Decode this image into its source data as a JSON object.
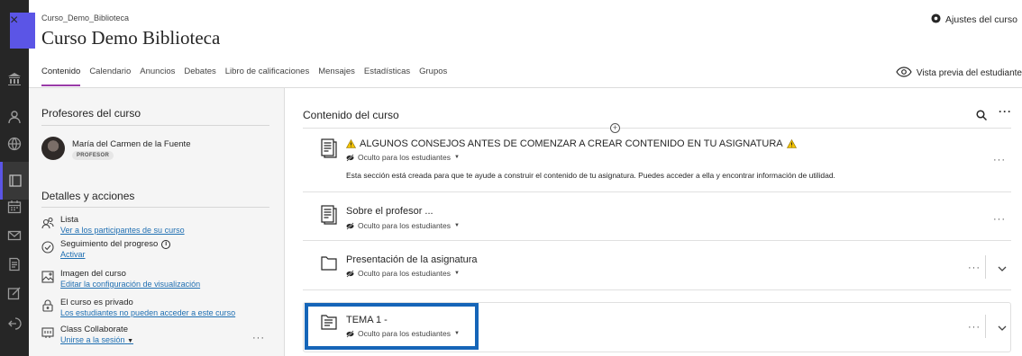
{
  "rail": {
    "close_label": "×",
    "icons": [
      "institution-icon",
      "user-icon",
      "globe-icon",
      "courses-icon",
      "calendar-icon",
      "mail-icon",
      "grades-icon",
      "tools-icon",
      "signout-icon"
    ]
  },
  "header": {
    "breadcrumb": "Curso_Demo_Biblioteca",
    "title": "Curso Demo Biblioteca",
    "settings_label": "Ajustes del curso"
  },
  "tabs": [
    {
      "label": "Contenido",
      "active": true
    },
    {
      "label": "Calendario",
      "active": false
    },
    {
      "label": "Anuncios",
      "active": false
    },
    {
      "label": "Debates",
      "active": false
    },
    {
      "label": "Libro de calificaciones",
      "active": false
    },
    {
      "label": "Mensajes",
      "active": false
    },
    {
      "label": "Estadísticas",
      "active": false
    },
    {
      "label": "Grupos",
      "active": false
    }
  ],
  "preview_label": "Vista previa del estudiante",
  "left": {
    "teachers_heading": "Profesores del curso",
    "teacher_name": "María del Carmen de la Fuente",
    "teacher_badge": "PROFESOR",
    "details_heading": "Detalles y acciones",
    "details": [
      {
        "title": "Lista",
        "link": "Ver a los participantes de su curso"
      },
      {
        "title": "Seguimiento del progreso",
        "link": "Activar"
      },
      {
        "title": "Imagen del curso",
        "link": "Editar la configuración de visualización"
      },
      {
        "title": "El curso es privado",
        "link": "Los estudiantes no pueden acceder a este curso"
      },
      {
        "title": "Class Collaborate",
        "link": "Unirse a la sesión"
      }
    ],
    "more": "···"
  },
  "content": {
    "heading": "Contenido del curso",
    "more": "···",
    "plus": "+",
    "items": [
      {
        "title": "ALGUNOS CONSEJOS ANTES DE COMENZAR A CREAR CONTENIDO EN TU ASIGNATURA",
        "status": "Oculto para los estudiantes",
        "description": "Esta sección está creada para que te ayude a construir el contenido de tu asignatura. Puedes acceder a ella y encontrar información de utilidad.",
        "more": "···"
      },
      {
        "title": "Sobre el profesor ...",
        "status": "Oculto para los estudiantes",
        "more": "···"
      },
      {
        "title": "Presentación de la asignatura",
        "status": "Oculto para los estudiantes",
        "more": "···"
      },
      {
        "title": "TEMA 1 -",
        "status": "Oculto para los estudiantes",
        "more": "···"
      }
    ]
  },
  "colors": {
    "rail": "#262626",
    "accent": "#5b55e6",
    "tab_underline": "#9a3ba8",
    "link": "#1f6fb2",
    "highlight": "#1565b8",
    "warning": "#f2c200"
  }
}
